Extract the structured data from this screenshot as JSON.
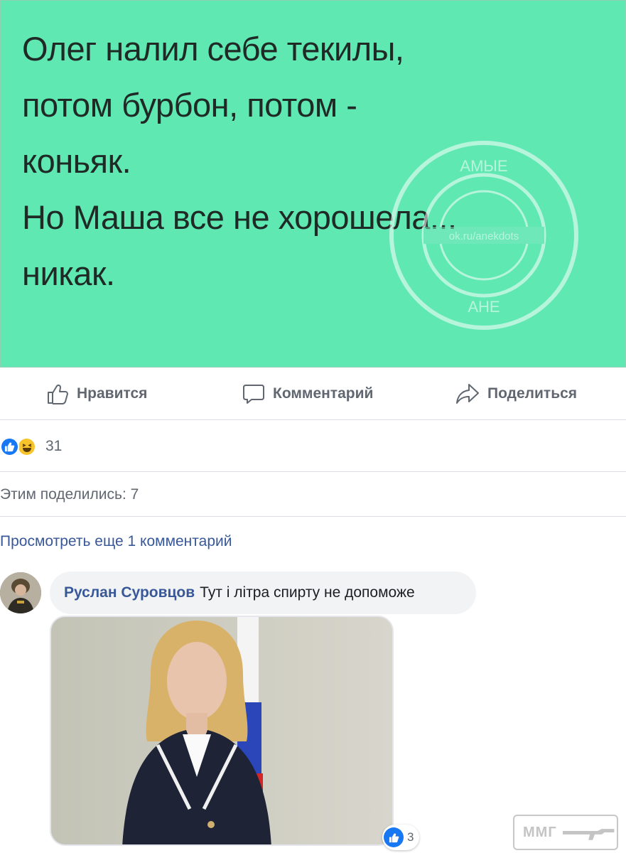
{
  "post": {
    "meme_lines": [
      "Олег налил себе текилы,",
      "потом бурбон, потом -",
      "коньяк.",
      "Но Маша все не хорошела...",
      "никак."
    ],
    "meme_bg": "#5fe8b2",
    "stamp_url": "ok.ru/anekdots"
  },
  "actions": {
    "like": "Нравится",
    "comment": "Комментарий",
    "share": "Поделиться"
  },
  "reactions": {
    "count": "31"
  },
  "shares": {
    "text": "Этим поделились: 7"
  },
  "comments": {
    "view_more": "Просмотреть еще 1 комментарий",
    "items": [
      {
        "author": "Руслан Суровцов",
        "text": "Тут і літра спирту не допоможе",
        "likes": "3"
      }
    ]
  },
  "watermark": {
    "text": "ММГ"
  },
  "colors": {
    "link": "#385898",
    "like_blue": "#1877f2",
    "muted": "#606770"
  }
}
